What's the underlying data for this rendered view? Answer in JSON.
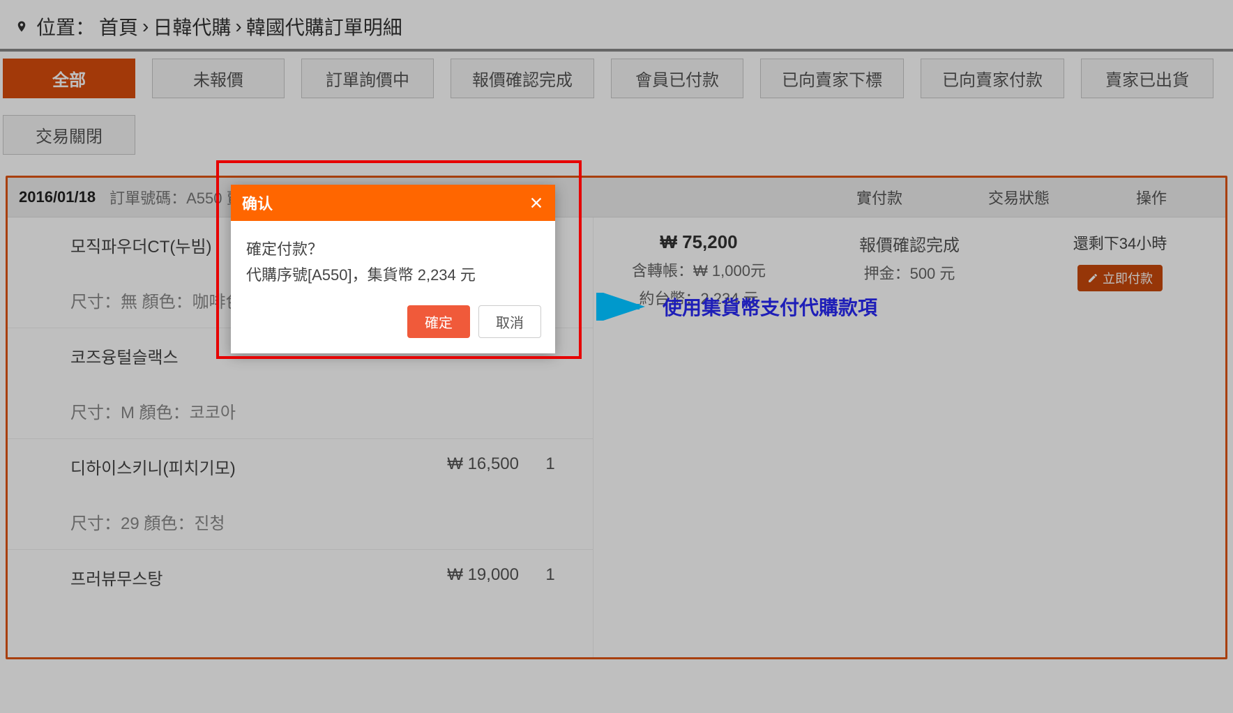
{
  "breadcrumb": {
    "label": "位置：",
    "home": "首頁",
    "sep": "›",
    "level1": "日韓代購",
    "level2": "韓國代購訂單明細"
  },
  "tabs": [
    {
      "label": "全部",
      "active": true
    },
    {
      "label": "未報價",
      "active": false
    },
    {
      "label": "訂單詢價中",
      "active": false
    },
    {
      "label": "報價確認完成",
      "active": false
    },
    {
      "label": "會員已付款",
      "active": false
    },
    {
      "label": "已向賣家下標",
      "active": false
    },
    {
      "label": "已向賣家付款",
      "active": false
    },
    {
      "label": "賣家已出貨",
      "active": false
    },
    {
      "label": "交易關閉",
      "active": false
    }
  ],
  "order": {
    "date": "2016/01/18",
    "order_no_label": "訂單號碼：",
    "order_no": "A550",
    "seller_prefix": "賣家",
    "cols": {
      "pay": "實付款",
      "status": "交易狀態",
      "action": "操作"
    },
    "items": [
      {
        "name": "모직파우더CT(누빔)",
        "attrs": "尺寸：無   顏色：咖啡色",
        "price": "",
        "qty": ""
      },
      {
        "name": "코즈융털슬랙스",
        "attrs": "尺寸：M   顏色：코코아",
        "price": "",
        "qty": ""
      },
      {
        "name": "디하이스키니(피치기모)",
        "attrs": "尺寸：29   顏色：진청",
        "price": "₩ 16,500",
        "qty": "1"
      },
      {
        "name": "프러뷰무스탕",
        "attrs": "",
        "price": "₩ 19,000",
        "qty": "1"
      }
    ],
    "payment": {
      "total": "₩ 75,200",
      "transfer": "含轉帳：₩ 1,000元",
      "twd": "約台幣：2,234 元"
    },
    "status": {
      "line1": "報價確認完成",
      "line2": "押金：500 元"
    },
    "action": {
      "remain": "還剩下34小時",
      "pay_btn": "立即付款"
    }
  },
  "modal": {
    "title": "确认",
    "body_line1": "確定付款？",
    "body_line2": "代購序號[A550]，集貨幣 2,234 元",
    "confirm": "確定",
    "cancel": "取消"
  },
  "annotation": "使用集貨幣支付代購款項"
}
